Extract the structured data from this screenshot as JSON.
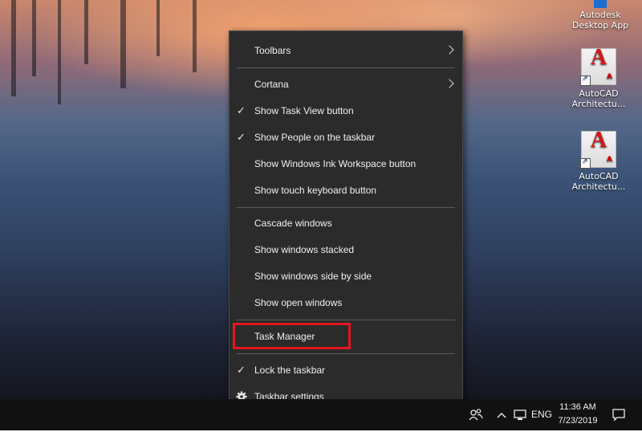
{
  "desktop": {
    "icons": [
      {
        "label_line1": "Autodesk",
        "label_line2": "Desktop App"
      },
      {
        "label_line1": "AutoCAD",
        "label_line2": "Architectu..."
      },
      {
        "label_line1": "AutoCAD",
        "label_line2": "Architectu..."
      }
    ]
  },
  "menu": {
    "items": [
      {
        "label": "Toolbars",
        "checked": false,
        "submenu": true
      },
      {
        "label": "Cortana",
        "checked": false,
        "submenu": true
      },
      {
        "label": "Show Task View button",
        "checked": true
      },
      {
        "label": "Show People on the taskbar",
        "checked": true
      },
      {
        "label": "Show Windows Ink Workspace button",
        "checked": false
      },
      {
        "label": "Show touch keyboard button",
        "checked": false
      },
      {
        "label": "Cascade windows",
        "checked": false
      },
      {
        "label": "Show windows stacked",
        "checked": false
      },
      {
        "label": "Show windows side by side",
        "checked": false
      },
      {
        "label": "Show open windows",
        "checked": false
      },
      {
        "label": "Task Manager",
        "checked": false,
        "highlighted": true
      },
      {
        "label": "Lock the taskbar",
        "checked": true
      },
      {
        "label": "Taskbar settings",
        "checked": false,
        "icon": "gear-icon"
      }
    ],
    "check_glyph": "✓",
    "highlight_color": "#e3161f"
  },
  "taskbar": {
    "language": "ENG",
    "time": "11:36 AM",
    "date": "7/23/2019"
  }
}
